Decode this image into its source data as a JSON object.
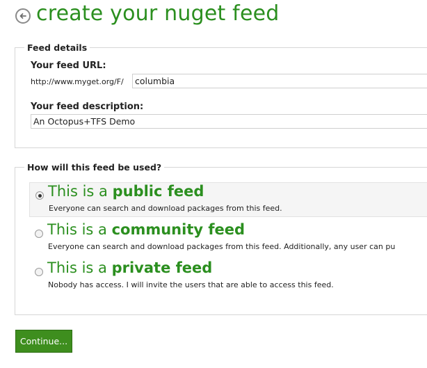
{
  "header": {
    "title": "create your nuget feed",
    "back_icon": "back-arrow-icon"
  },
  "feed_details": {
    "legend": "Feed details",
    "url_label": "Your feed URL:",
    "url_prefix": "http://www.myget.org/F/",
    "url_value": "columbia",
    "description_label": "Your feed description:",
    "description_value": "An Octopus+TFS Demo"
  },
  "usage": {
    "legend": "How will this feed be used?",
    "options": [
      {
        "prefix": "This is a",
        "emphasis": "public feed",
        "description": "Everyone can search and download packages from this feed.",
        "selected": true
      },
      {
        "prefix": "This is a",
        "emphasis": "community feed",
        "description": "Everyone can search and download packages from this feed. Additionally, any user can pu",
        "selected": false
      },
      {
        "prefix": "This is a",
        "emphasis": "private feed",
        "description": "Nobody has access. I will invite the users that are able to access this feed.",
        "selected": false
      }
    ]
  },
  "actions": {
    "continue_label": "Continue..."
  },
  "colors": {
    "accent_green": "#2b8f1f",
    "button_green": "#3e8e1e"
  }
}
